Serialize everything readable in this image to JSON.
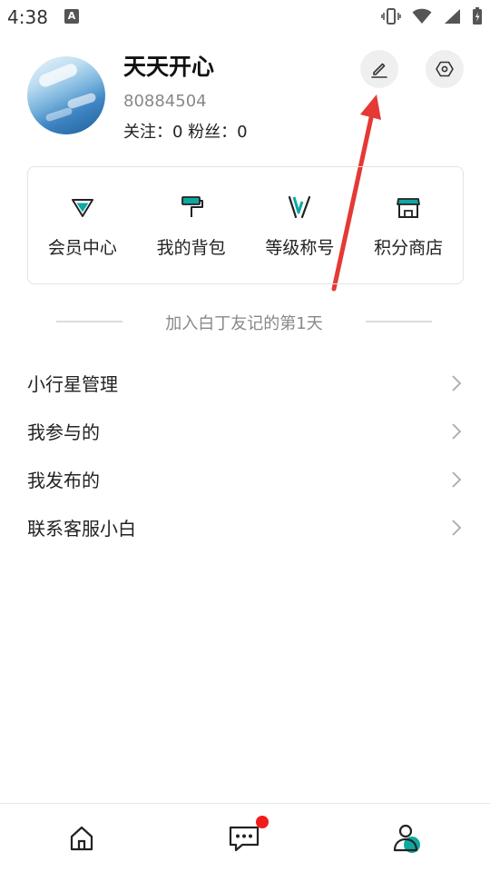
{
  "status_bar": {
    "time": "4:38",
    "app_icon_letter": "A"
  },
  "profile": {
    "name": "天天开心",
    "id": "80884504",
    "stats": "关注：0  粉丝：0"
  },
  "actions": {
    "edit_icon": "pencil-icon",
    "settings_icon": "hexagon-gear-icon"
  },
  "features": [
    {
      "label": "会员中心",
      "icon": "diamond-icon",
      "color": "#0fa8a0"
    },
    {
      "label": "我的背包",
      "icon": "paint-roller-icon",
      "color": "#0fa8a0"
    },
    {
      "label": "等级称号",
      "icon": "v-badge-icon",
      "color": "#0fa8a0"
    },
    {
      "label": "积分商店",
      "icon": "storefront-icon",
      "color": "#0fa8a0"
    }
  ],
  "join_text": "加入白丁友记的第1天",
  "menu": [
    {
      "label": "小行星管理"
    },
    {
      "label": "我参与的"
    },
    {
      "label": "我发布的"
    },
    {
      "label": "联系客服小白"
    }
  ],
  "bottom_nav": [
    {
      "name": "home",
      "icon": "home-icon"
    },
    {
      "name": "messages",
      "icon": "chat-bubble-icon",
      "has_badge": true
    },
    {
      "name": "profile",
      "icon": "user-icon",
      "active": true
    }
  ],
  "colors": {
    "accent": "#0fa8a0",
    "badge": "#f21b1b",
    "annotation_arrow": "#e53935"
  }
}
